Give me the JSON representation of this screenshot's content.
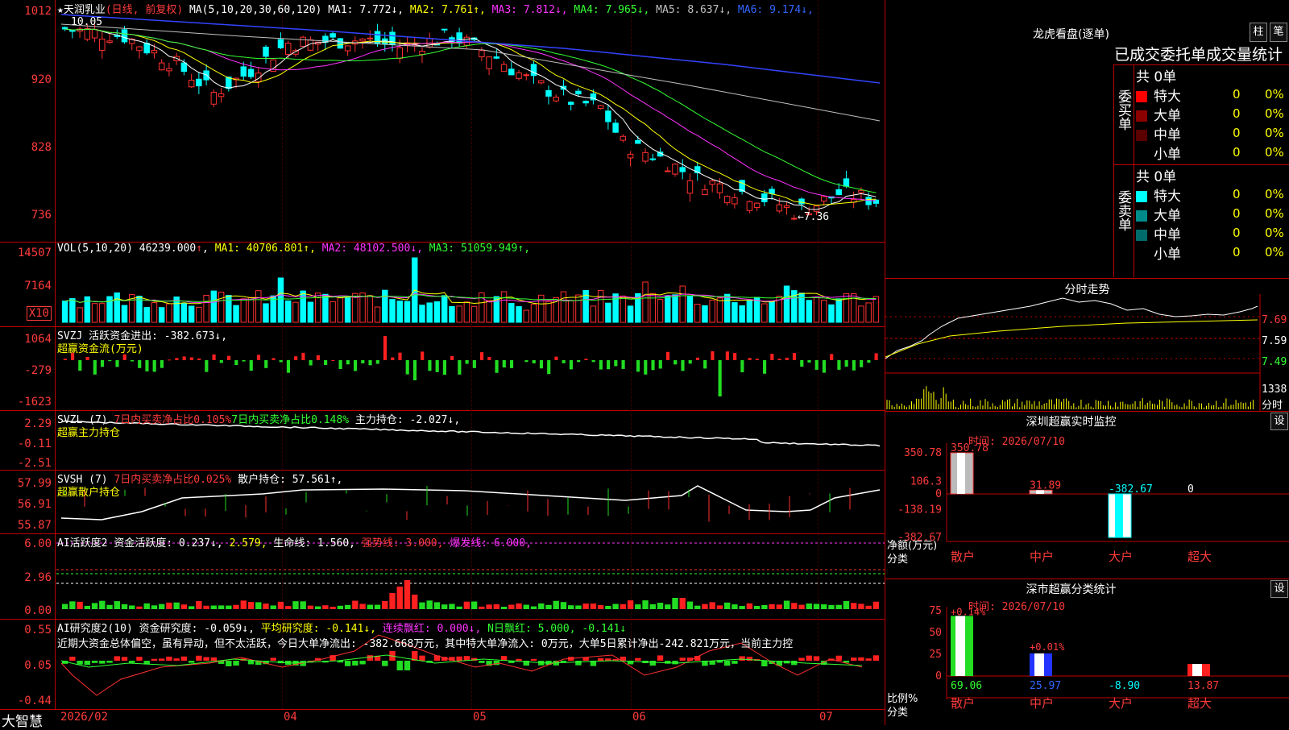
{
  "stock": {
    "name": "天润乳业",
    "period": "(日线, 前复权)",
    "ma_header": "MA(5,10,20,30,60,120)",
    "ma": [
      {
        "label": "MA1:",
        "value": "7.772",
        "arrow": "↓",
        "color": "#ffffff"
      },
      {
        "label": "MA2:",
        "value": "7.761",
        "arrow": "↑",
        "color": "#ffff00"
      },
      {
        "label": "MA3:",
        "value": "7.812",
        "arrow": "↓",
        "color": "#ff33ff"
      },
      {
        "label": "MA4:",
        "value": "7.965",
        "arrow": "↓",
        "color": "#33ff33"
      },
      {
        "label": "MA5:",
        "value": "8.637",
        "arrow": "↓",
        "color": "#c0c0c0"
      },
      {
        "label": "MA6:",
        "value": "9.174",
        "arrow": "↓",
        "color": "#3366ff"
      }
    ],
    "high_label": "10.05",
    "low_label": "←7.36",
    "price_ticks": [
      "1012",
      "920",
      "828",
      "736"
    ]
  },
  "volume": {
    "header": "VOL(5,10,20)",
    "value": "46239.000",
    "arrow": "↑",
    "ma": [
      {
        "label": "MA1:",
        "value": "40706.801",
        "arrow": "↑",
        "color": "#ffff00"
      },
      {
        "label": "MA2:",
        "value": "48102.500",
        "arrow": "↓",
        "color": "#ff33ff"
      },
      {
        "label": "MA3:",
        "value": "51059.949",
        "arrow": "↑",
        "color": "#33ff33"
      }
    ],
    "ticks": [
      "14507",
      "7164"
    ],
    "unit": "X10"
  },
  "svzj": {
    "header": "SVZJ",
    "line1": "活跃资金进出: -382.673↓,",
    "line2": "超赢资金流(万元)",
    "ticks": [
      "1064",
      "-279",
      "-1623"
    ]
  },
  "svzl": {
    "header": "SVZL (7)",
    "a": "7日内买卖净占比0.105%",
    "b": "7日内买卖净占比0.148%",
    "c": "主力持仓: -2.027↓,",
    "line2": "超赢主力持仓",
    "ticks": [
      "2.29",
      "-0.11",
      "-2.51"
    ]
  },
  "svsh": {
    "header": "SVSH (7)",
    "a": "7日内买卖净占比0.025%",
    "c": "散户持仓: 57.561↑,",
    "line2": "超赢散户持仓",
    "ticks": [
      "57.99",
      "56.91",
      "55.87"
    ]
  },
  "ai1": {
    "header": "AI活跃度2",
    "a": "资金活跃度: 0.237↓,",
    "b": "2.579,",
    "c": "生命线: 1.560,",
    "d": "强势线: 3.000,",
    "e": "爆发线: 6.000,",
    "ticks": [
      "6.00",
      "2.96",
      "0.00"
    ]
  },
  "ai2": {
    "header": "AI研究度2(10)",
    "a": "资金研究度: -0.059↓,",
    "b": "平均研究度: -0.141↓,",
    "c": "连续飘红: 0.000↓,",
    "d": "N日飘红: 5.000,",
    "e": "-0.141↓",
    "summary": "近期大资金总体偏空，虽有异动，但不太活跃，今日大单净流出: -382.668万元，其中特大单净流入: 0万元，大单5日累计净出-242.821万元，当前主力控",
    "ticks": [
      "0.55",
      "0.05",
      "-0.44"
    ]
  },
  "xaxis": {
    "labels": [
      "2026/02",
      "04",
      "05",
      "06",
      "07"
    ],
    "brand": "大智慧"
  },
  "longhu": {
    "title": "龙虎看盘(逐单)",
    "btn_bar": "柱",
    "btn_line": "笔",
    "tabs": "已成交委托单成交量统计",
    "buy_side": "委买单",
    "sell_side": "委卖单",
    "buy_total": "共 0单",
    "sell_total": "共 0单",
    "buy_rows": [
      {
        "name": "特大",
        "count": "0",
        "pct": "0%",
        "color": "#ff0000"
      },
      {
        "name": "大单",
        "count": "0",
        "pct": "0%",
        "color": "#8b0000"
      },
      {
        "name": "中单",
        "count": "0",
        "pct": "0%",
        "color": "#5a0000"
      },
      {
        "name": "小单",
        "count": "0",
        "pct": "0%",
        "color": ""
      }
    ],
    "sell_rows": [
      {
        "name": "特大",
        "count": "0",
        "pct": "0%",
        "color": "#00ffff"
      },
      {
        "name": "大单",
        "count": "0",
        "pct": "0%",
        "color": "#008b8b"
      },
      {
        "name": "中单",
        "count": "0",
        "pct": "0%",
        "color": "#006b6b"
      },
      {
        "name": "小单",
        "count": "0",
        "pct": "0%",
        "color": ""
      }
    ]
  },
  "intraday": {
    "title": "分时走势",
    "ticks": [
      "7.69",
      "7.59",
      "7.49"
    ],
    "vol_tick": "1338",
    "vol_unit": "分时"
  },
  "sz_monitor": {
    "title": "深圳超赢实时监控",
    "btn": "设",
    "time": "时间: 2026/07/10",
    "ticks": [
      "350.78",
      "106.3",
      "0",
      "-138.19",
      "-382.67"
    ],
    "ylabel1": "净额(万元)",
    "ylabel2": "分类",
    "categories": [
      "散户",
      "中户",
      "大户",
      "超大"
    ],
    "values": [
      350.78,
      31.89,
      -382.67,
      0
    ],
    "value_labels": [
      "350.78",
      "31.89",
      "-382.67",
      "0"
    ]
  },
  "sz_class": {
    "title": "深市超赢分类统计",
    "btn": "设",
    "time": "时间: 2026/07/10",
    "ticks": [
      "75",
      "50",
      "25",
      "0"
    ],
    "ylabel1": "比例%",
    "ylabel2": "分类",
    "categories": [
      "散户",
      "中户",
      "大户",
      "超大"
    ],
    "values": [
      69.06,
      25.97,
      -8.9,
      13.87
    ],
    "value_labels": [
      "69.06",
      "25.97",
      "-8.90",
      "13.87"
    ],
    "top_labels": [
      "+0.14%",
      "+0.01%"
    ]
  }
}
